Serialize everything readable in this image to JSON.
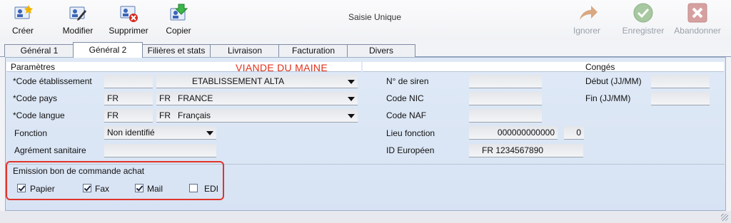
{
  "window": {
    "title": "Saisie Unique"
  },
  "toolbar": {
    "creer": "Créer",
    "modifier": "Modifier",
    "supprimer": "Supprimer",
    "copier": "Copier",
    "ignorer": "Ignorer",
    "enregistrer": "Enregistrer",
    "abandonner": "Abandonner"
  },
  "tabs": [
    "Général 1",
    "Général 2",
    "Filières et stats",
    "Livraison",
    "Facturation",
    "Divers"
  ],
  "active_tab": "Général 2",
  "company_name": "VIANDE DU MAINE",
  "parametres": {
    "title": "Paramètres",
    "code_etab_label": "*Code établissement",
    "code_etab_code": "",
    "code_etab_name": "ETABLISSEMENT ALTA",
    "code_pays_label": "*Code pays",
    "code_pays_code": "FR",
    "code_pays_sel_code": "FR",
    "code_pays_sel_name": "FRANCE",
    "code_langue_label": "*Code langue",
    "code_langue_code": "FR",
    "code_langue_sel_code": "FR",
    "code_langue_sel_name": "Français",
    "fonction_label": "Fonction",
    "fonction_value": "Non identifié",
    "agrement_label": "Agrément sanitaire",
    "agrement_value": ""
  },
  "ids": {
    "siren_label": "N° de siren",
    "siren_value": "",
    "nic_label": "Code NIC",
    "nic_value": "",
    "naf_label": "Code NAF",
    "naf_value": "",
    "lieu_label": "Lieu fonction",
    "lieu_value": "000000000000",
    "lieu_suffix": "0",
    "euro_label": "ID Européen",
    "euro_value": "FR 1234567890"
  },
  "conges": {
    "title": "Congés",
    "debut_label": "Début (JJ/MM)",
    "debut_value": "",
    "fin_label": "Fin (JJ/MM)",
    "fin_value": ""
  },
  "emission": {
    "title": "Emission bon de commande achat",
    "papier": "Papier",
    "fax": "Fax",
    "mail": "Mail",
    "edi": "EDI",
    "papier_checked": true,
    "fax_checked": true,
    "mail_checked": true,
    "edi_checked": false
  },
  "colors": {
    "accent_red": "#e0321b",
    "panel_bg": "#dbe6f5",
    "highlight_border": "#e0342a"
  }
}
